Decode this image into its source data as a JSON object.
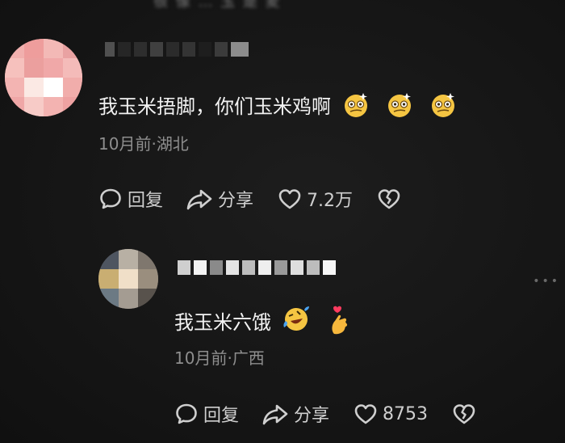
{
  "top_fragment": "很 像 … 玉 是 麦",
  "comments": [
    {
      "text": "我玉米捂脚，你们玉米鸡啊",
      "time": "10月前",
      "separator": "·",
      "location": "湖北",
      "reply_label": "回复",
      "share_label": "分享",
      "likes": "7.2万",
      "emojis": [
        "dizzy-face-emoji",
        "dizzy-face-emoji",
        "dizzy-face-emoji"
      ]
    },
    {
      "text": "我玉米六饿",
      "time": "10月前",
      "separator": "·",
      "location": "广西",
      "reply_label": "回复",
      "share_label": "分享",
      "likes": "8753",
      "emojis": [
        "rofl-emoji",
        "finger-heart-emoji"
      ]
    }
  ],
  "icons": {
    "reply": "speech-bubble-icon",
    "share": "share-arrow-icon",
    "like": "heart-outline-icon",
    "dislike": "broken-heart-icon",
    "more": "more-dots-icon"
  },
  "colors": {
    "background": "#141414",
    "text_primary": "#f2f2f2",
    "text_meta": "#8e8e8e",
    "action": "#cfcfcf"
  }
}
